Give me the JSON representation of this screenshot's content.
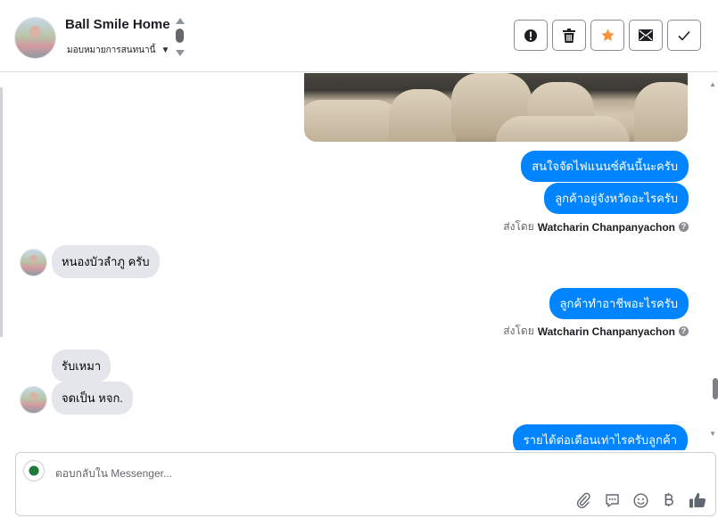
{
  "header": {
    "title": "Ball Smile Home",
    "assign_label": "มอบหมายการสนทนานี้",
    "actions": [
      {
        "name": "mark-spam-button",
        "icon": "alert-icon"
      },
      {
        "name": "delete-button",
        "icon": "trash-icon"
      },
      {
        "name": "star-button",
        "icon": "star-icon"
      },
      {
        "name": "mark-unread-button",
        "icon": "envelope-icon"
      },
      {
        "name": "mark-done-button",
        "icon": "check-icon"
      }
    ],
    "star_color": "#f7923b"
  },
  "messages": {
    "out1": "สนใจจัดไฟแนนซ์คันนี้นะครับ",
    "out2": "ลูกค้าอยู่จังหวัดอะไรครับ",
    "sent_prefix": "ส่งโดย",
    "sender": "Watcharin Chanpanyachon",
    "in1": "หนองบัวลำภู ครับ",
    "out3": "ลูกค้าทำอาชีพอะไรครับ",
    "in2": "รับเหมา",
    "in3": "จดเป็น หจก.",
    "out4": "รายได้ต่อเดือนเท่าไรครับลูกค้า"
  },
  "composer": {
    "placeholder": "ตอบกลับใน Messenger..."
  },
  "colors": {
    "outgoing_bubble": "#0084ff",
    "incoming_bubble": "#e4e6eb"
  }
}
